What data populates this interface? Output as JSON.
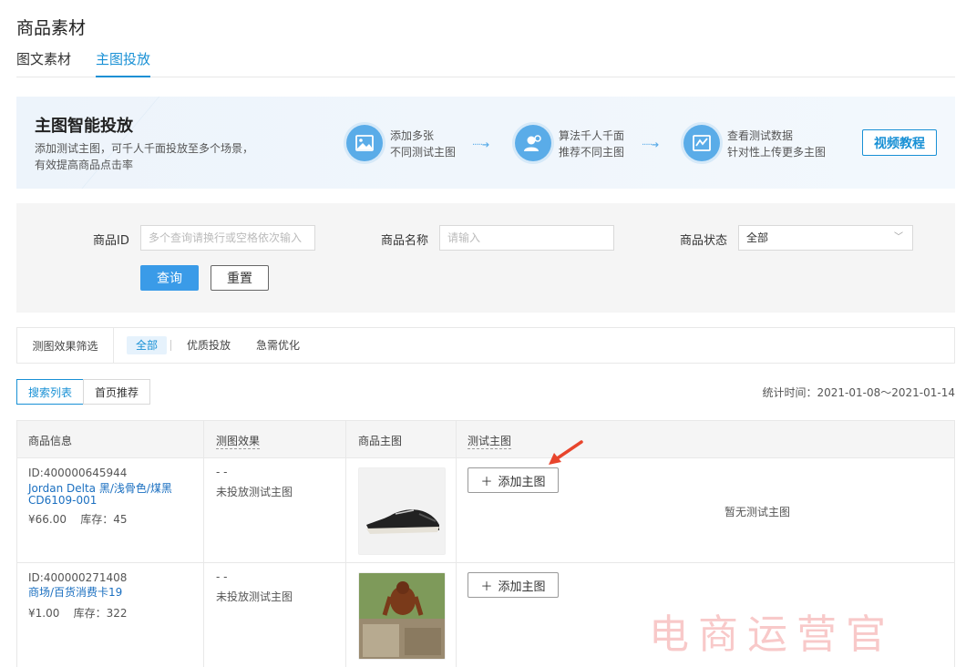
{
  "header": {
    "title": "商品素材",
    "tabs": [
      {
        "label": "图文素材",
        "active": false
      },
      {
        "label": "主图投放",
        "active": true
      }
    ]
  },
  "banner": {
    "title": "主图智能投放",
    "desc": "添加测试主图，可千人千面投放至多个场景，有效提高商品点击率",
    "steps": [
      {
        "icon": "image-icon",
        "line1": "添加多张",
        "line2": "不同测试主图"
      },
      {
        "icon": "users-icon",
        "line1": "算法千人千面",
        "line2": "推荐不同主图"
      },
      {
        "icon": "trend-chart-icon",
        "line1": "查看测试数据",
        "line2": "针对性上传更多主图"
      }
    ],
    "video_button": "视频教程"
  },
  "filters": {
    "product_id_label": "商品ID",
    "product_id_placeholder": "多个查询请换行或空格依次输入",
    "product_name_label": "商品名称",
    "product_name_placeholder": "请输入",
    "product_status_label": "商品状态",
    "product_status_value": "全部",
    "query_button": "查询",
    "reset_button": "重置"
  },
  "effect_filter": {
    "label": "测图效果筛选",
    "options": [
      {
        "label": "全部",
        "active": true
      },
      {
        "label": "优质投放",
        "active": false
      },
      {
        "label": "急需优化",
        "active": false
      }
    ]
  },
  "list_tabs": [
    {
      "label": "搜索列表",
      "active": true
    },
    {
      "label": "首页推荐",
      "active": false
    }
  ],
  "stat_time": "统计时间：2021-01-08～2021-01-14",
  "table": {
    "columns": [
      "商品信息",
      "测图效果",
      "商品主图",
      "测试主图"
    ],
    "rows": [
      {
        "id": "ID:400000645944",
        "name": "Jordan Delta 黑/浅骨色/煤黑 CD6109-001",
        "price": "¥66.00",
        "stock": "库存：45",
        "effect_dash": "- -",
        "effect_text": "未投放测试主图",
        "image": "sneaker-image",
        "add_button": "添加主图",
        "empty_text": "暂无测试主图"
      },
      {
        "id": "ID:400000271408",
        "name": "商场/百货消费卡19",
        "price": "¥1.00",
        "stock": "库存：322",
        "effect_dash": "- -",
        "effect_text": "未投放测试主图",
        "image": "orangutan-image",
        "add_button": "添加主图",
        "empty_text": ""
      }
    ]
  },
  "watermark": "电商运营官",
  "colors": {
    "accent": "#1890d5",
    "primary_button": "#3a9be8",
    "annotation_arrow": "#e8452c"
  }
}
